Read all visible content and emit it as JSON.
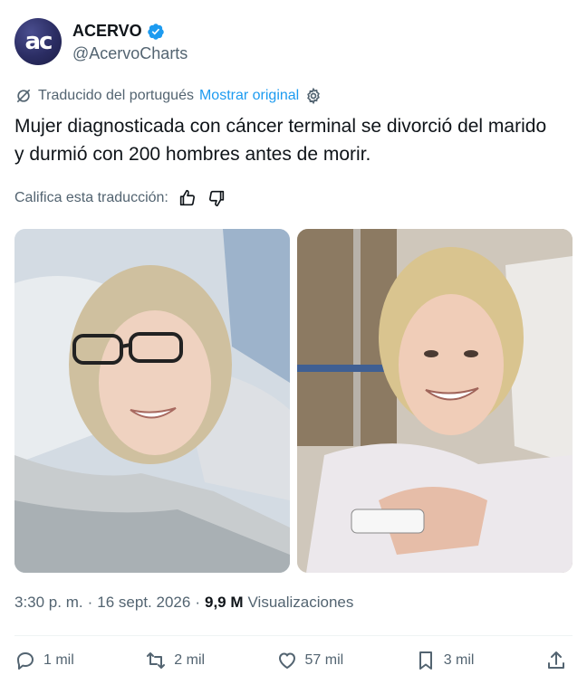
{
  "author": {
    "avatar_text": "ac",
    "display_name": "ACERVO",
    "handle": "@AcervoCharts",
    "verified_color": "#1d9bf0"
  },
  "translation": {
    "note": "Traducido del portugués",
    "show_original": "Mostrar original",
    "rate_label": "Califica esta traducción:"
  },
  "tweet": {
    "text": "Mujer diagnosticada con cáncer terminal se divorció del marido y durmió con 200 hombres antes de morir."
  },
  "meta": {
    "time": "3:30 p. m.",
    "separator1": "·",
    "date": "16 sept. 2026",
    "separator2": "·",
    "views_count": "9,9 M",
    "views_label": "Visualizaciones"
  },
  "actions": {
    "replies": "1 mil",
    "reposts": "2 mil",
    "likes": "57 mil",
    "bookmarks": "3 mil"
  },
  "icons": {
    "translate": "translate-off-icon",
    "settings": "gear-icon",
    "thumbs_up": "thumbs-up-icon",
    "thumbs_down": "thumbs-down-icon",
    "reply": "reply-icon",
    "repost": "repost-icon",
    "like": "heart-icon",
    "bookmark": "bookmark-icon",
    "share": "share-icon"
  },
  "colors": {
    "accent": "#1d9bf0",
    "secondary_text": "#536471"
  }
}
